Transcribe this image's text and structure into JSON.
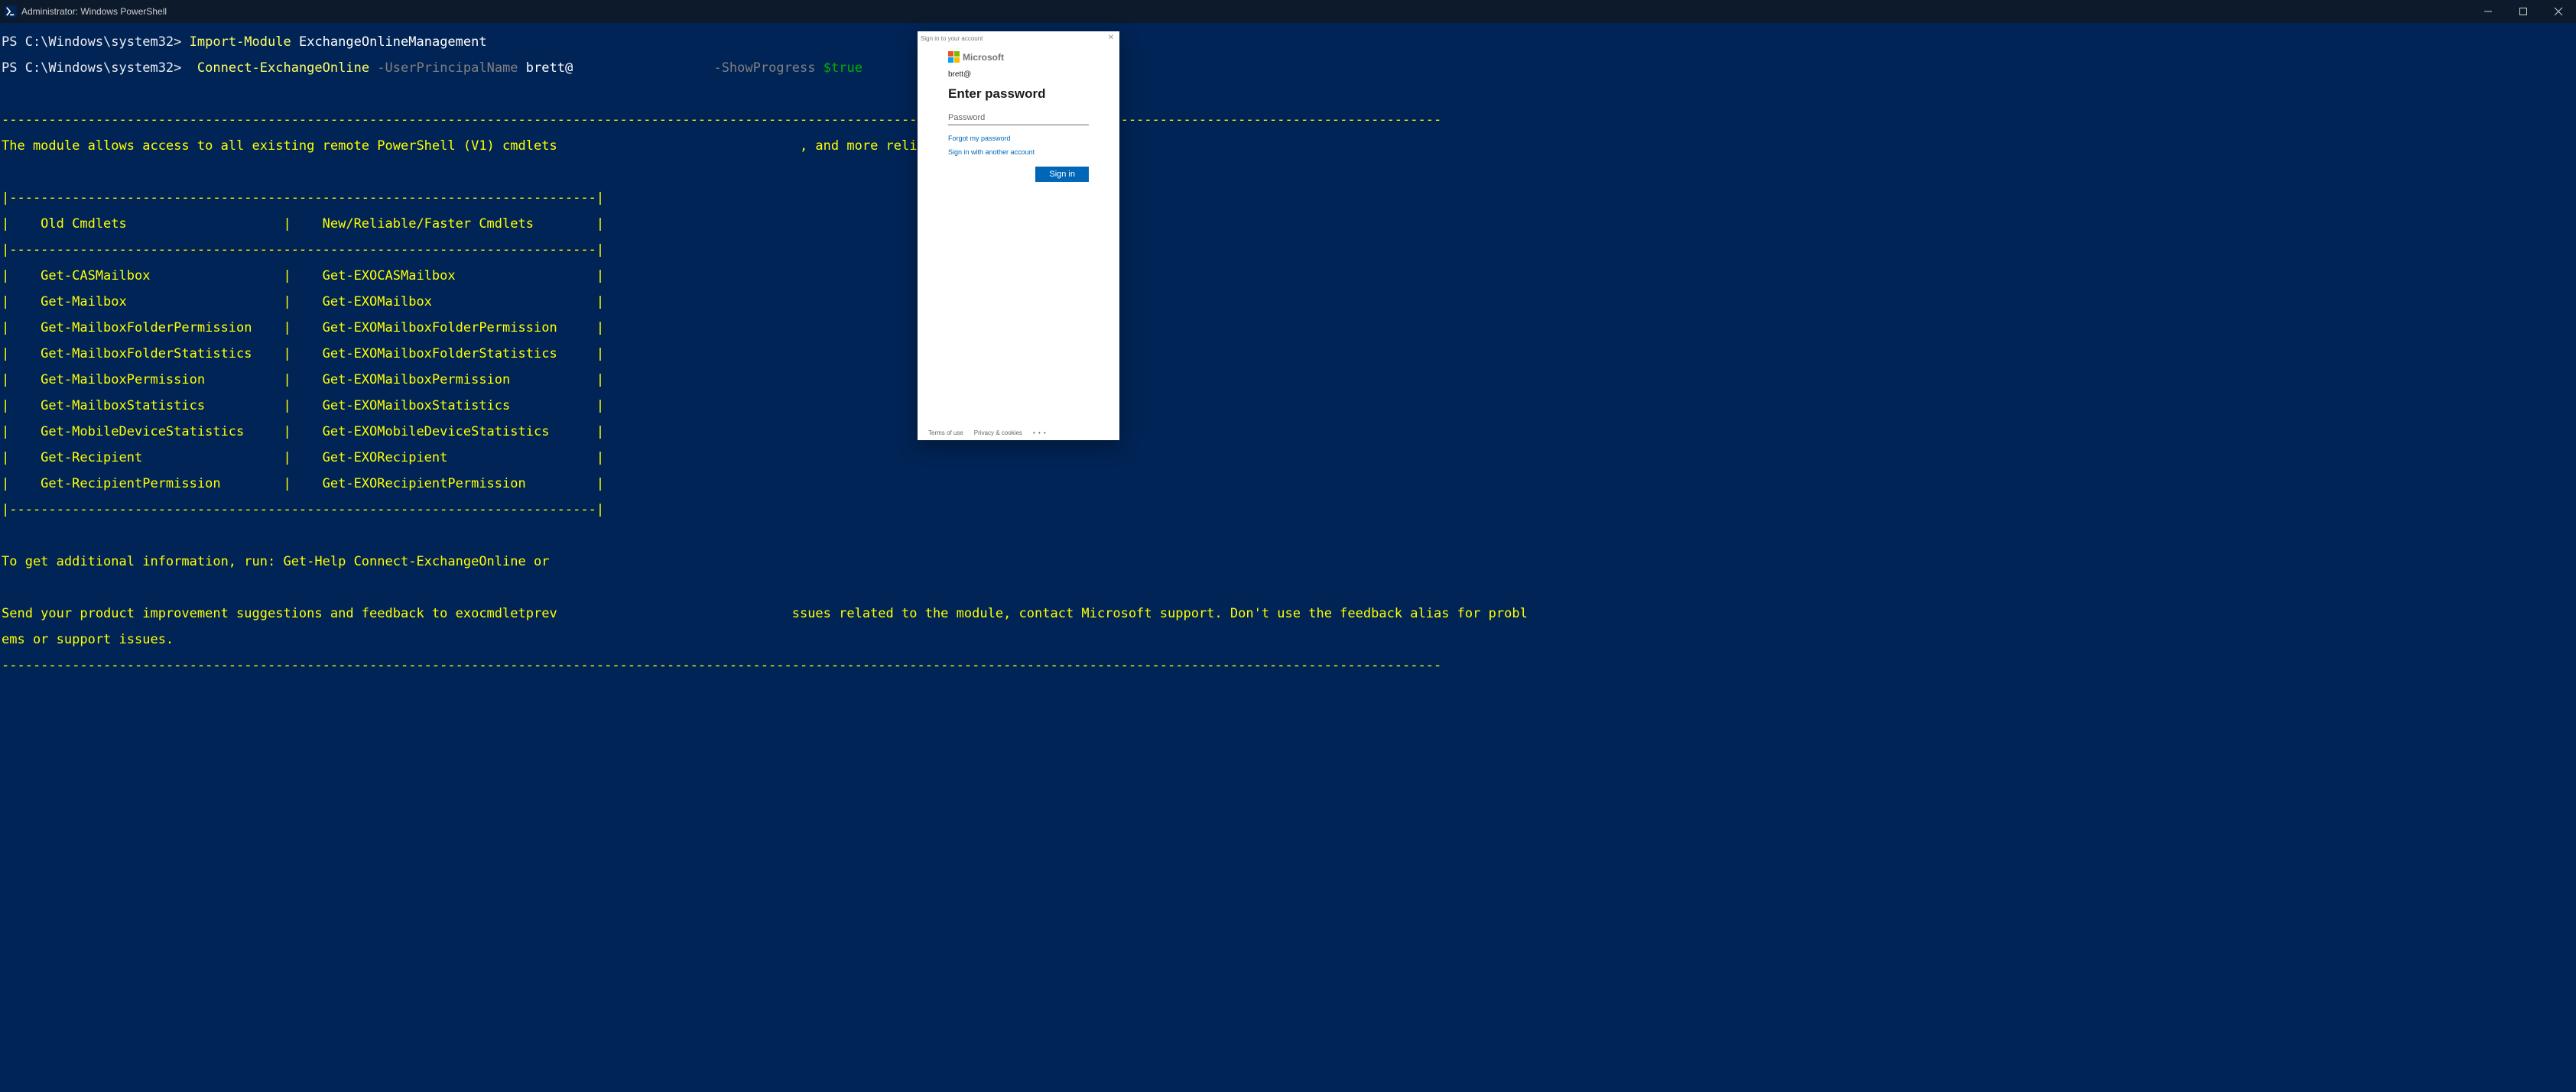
{
  "window": {
    "title": "Administrator: Windows PowerShell"
  },
  "terminal": {
    "prompt": "PS C:\\Windows\\system32>",
    "line1": {
      "cmd": "Import-Module",
      "module": "ExchangeOnlineManagement"
    },
    "line2": {
      "cmd": "Connect-ExchangeOnline",
      "p1": "-UserPrincipalName",
      "v1": "brett@",
      "p2": "-ShowProgress",
      "v2": "$true"
    },
    "dash_full": "----------------------------------------------------------------------------------------------------------------------------------------------------------------------------------------",
    "intro": "The module allows access to all existing remote PowerShell (V1) cmdlets                               , and more reliable cmdlets.",
    "tbl_top": "|---------------------------------------------------------------------------|",
    "tbl_hdr": "|    Old Cmdlets                    |    New/Reliable/Faster Cmdlets        |",
    "tbl_sep": "|---------------------------------------------------------------------------|",
    "rows": [
      "|    Get-CASMailbox                 |    Get-EXOCASMailbox                  |",
      "|    Get-Mailbox                    |    Get-EXOMailbox                     |",
      "|    Get-MailboxFolderPermission    |    Get-EXOMailboxFolderPermission     |",
      "|    Get-MailboxFolderStatistics    |    Get-EXOMailboxFolderStatistics     |",
      "|    Get-MailboxPermission          |    Get-EXOMailboxPermission           |",
      "|    Get-MailboxStatistics          |    Get-EXOMailboxStatistics           |",
      "|    Get-MobileDeviceStatistics     |    Get-EXOMobileDeviceStatistics      |",
      "|    Get-Recipient                  |    Get-EXORecipient                   |",
      "|    Get-RecipientPermission        |    Get-EXORecipientPermission         |"
    ],
    "tbl_bot": "|---------------------------------------------------------------------------|",
    "help": "To get additional information, run: Get-Help Connect-ExchangeOnline or ",
    "feedback1": "Send your product improvement suggestions and feedback to exocmdletprev                              ssues related to the module, contact Microsoft support. Don't use the feedback alias for probl",
    "feedback2": "ems or support issues.",
    "dash_full2": "----------------------------------------------------------------------------------------------------------------------------------------------------------------------------------------"
  },
  "modal": {
    "window_title": "Sign in to your account",
    "logo_text": "Microsoft",
    "identity": "brett@",
    "heading": "Enter password",
    "pw_placeholder": "Password",
    "forgot": "Forgot my password",
    "another": "Sign in with another account",
    "signin": "Sign in",
    "footer": {
      "terms": "Terms of use",
      "privacy": "Privacy & cookies",
      "more": "• • •"
    }
  }
}
